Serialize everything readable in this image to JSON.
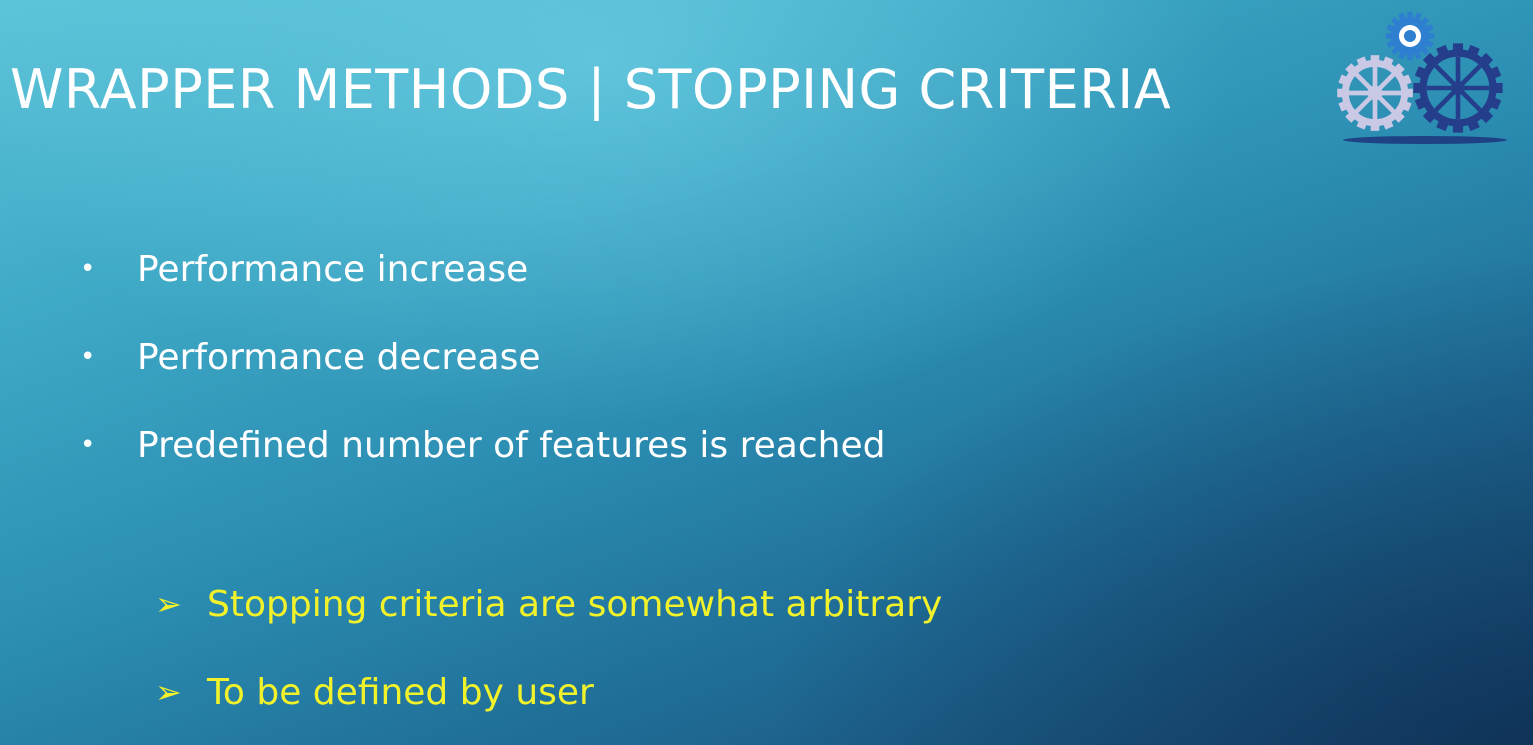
{
  "slide": {
    "title": "WRAPPER METHODS | STOPPING CRITERIA",
    "bullets": [
      {
        "icon": "bullet-dot",
        "text": "Performance increase"
      },
      {
        "icon": "bullet-dot",
        "text": "Performance decrease"
      },
      {
        "icon": "bullet-dot",
        "text": "Predefined number of features is reached"
      }
    ],
    "notes": [
      {
        "icon": "arrow-bullet-icon",
        "text": "Stopping criteria are somewhat arbitrary"
      },
      {
        "icon": "arrow-bullet-icon",
        "text": "To be defined by user"
      }
    ],
    "decoration": {
      "icon": "gears-icon"
    },
    "colors": {
      "title": "#ffffff",
      "bullet_text": "#ffffff",
      "note_text": "#f2f22a",
      "background_top": "#5cc3d8",
      "background_bottom": "#17466f"
    },
    "glyphs": {
      "dot": "•",
      "arrow": "➢"
    }
  }
}
